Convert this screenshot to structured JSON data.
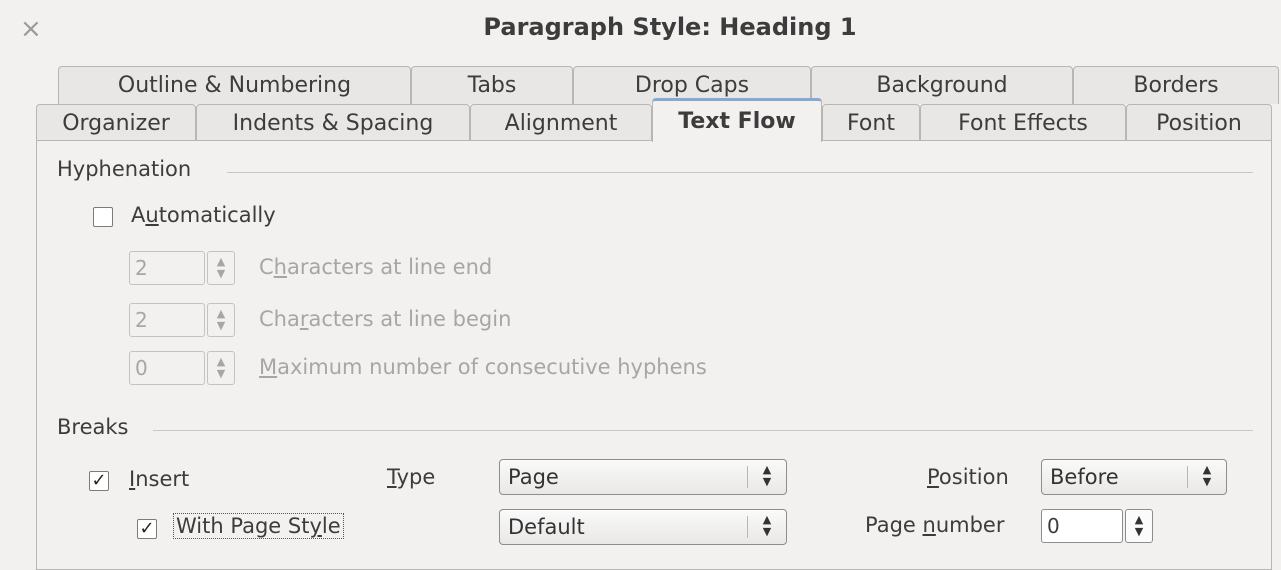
{
  "window": {
    "title": "Paragraph Style: Heading 1",
    "close_glyph": "×"
  },
  "tabs_row1": [
    "Outline & Numbering",
    "Tabs",
    "Drop Caps",
    "Background",
    "Borders"
  ],
  "tabs_row2": [
    "Organizer",
    "Indents & Spacing",
    "Alignment",
    "Text Flow",
    "Font",
    "Font Effects",
    "Position"
  ],
  "active_tab": "Text Flow",
  "hyphenation": {
    "section_label": "Hyphenation",
    "automatically": {
      "pre": "A",
      "ul": "u",
      "post": "tomatically",
      "checked": false
    },
    "chars_line_end": {
      "value": "2",
      "pre": "C",
      "ul": "h",
      "post": "aracters at line end"
    },
    "chars_line_begin": {
      "value": "2",
      "pre": "Cha",
      "ul": "r",
      "post": "acters at line begin"
    },
    "max_hyphens": {
      "value": "0",
      "pre": "",
      "ul": "M",
      "post": "aximum number of consecutive hyphens"
    }
  },
  "breaks": {
    "section_label": "Breaks",
    "insert": {
      "pre": "",
      "ul": "I",
      "post": "nsert",
      "checked": true,
      "check_glyph": "✓"
    },
    "type": {
      "pre": "",
      "ul": "T",
      "post": "ype",
      "value": "Page"
    },
    "position": {
      "pre": "",
      "ul": "P",
      "post": "osition",
      "value": "Before"
    },
    "with_page_style": {
      "pre": "With Page St",
      "ul": "y",
      "post": "le",
      "checked": true,
      "check_glyph": "✓",
      "value": "Default"
    },
    "page_number": {
      "pre": "Page ",
      "ul": "n",
      "post": "umber",
      "value": "0"
    }
  },
  "icons": {
    "spin_up": "▲",
    "spin_down": "▼",
    "combo_arrows": "▲▼"
  }
}
